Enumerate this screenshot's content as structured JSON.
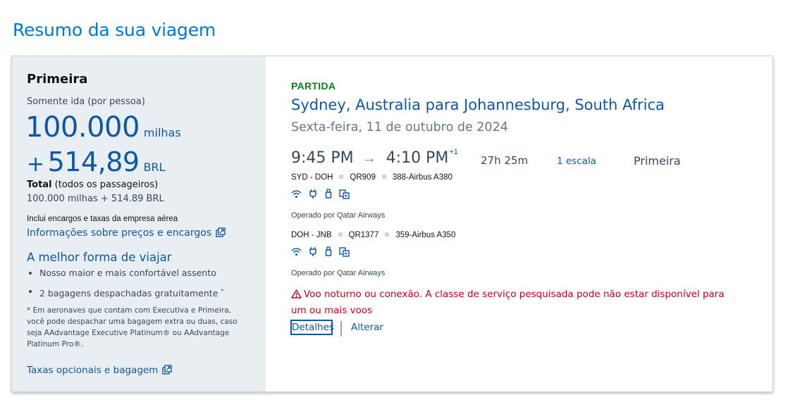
{
  "page": {
    "title": "Resumo da sua viagem"
  },
  "summary": {
    "cabin": "Primeira",
    "trip_type": "Somente ida (por pessoa)",
    "miles": "100.000",
    "miles_unit": "milhas",
    "plus": "+",
    "price": "514,89",
    "currency": "BRL",
    "total_label": "Total",
    "total_suffix": " (todos os passageiros)",
    "total_value": "100.000 milhas + 514.89 BRL",
    "fees_note": "Inclui encargos e taxas da empresa aérea",
    "price_info_link": "Informações sobre preços e encargos",
    "best_way_title": "A melhor forma de viajar",
    "benefits": [
      "Nosso maior e mais confortável assento",
      "2 bagagens despachadas gratuitamente"
    ],
    "benefit_mark": "*",
    "footnote": "* Em aeronaves que contam com Executiva e Primeira, você pode despachar uma bagagem extra ou duas, caso seja AAdvantage Executive Platinum® ou AAdvantage Platinum Pro®.",
    "optional_fees_link": "Taxas opcionais e bagagem"
  },
  "flight": {
    "direction": "PARTIDA",
    "route": "Sydney, Australia para Johannesburg, South Africa",
    "date": "Sexta-feira, 11 de outubro de 2024",
    "depart_time": "9:45 PM",
    "arrow": "→",
    "arrive_time": "4:10 PM",
    "day_offset": "+1",
    "duration": "27h 25m",
    "stops": "1 escala",
    "cabin": "Primeira",
    "segments": [
      {
        "route": "SYD - DOH",
        "flight": "QR909",
        "aircraft": "388-Airbus A380",
        "operated_by": "Operado por Qatar Airways"
      },
      {
        "route": "DOH - JNB",
        "flight": "QR1377",
        "aircraft": "359-Airbus A350",
        "operated_by": "Operado por Qatar Airways"
      }
    ],
    "amenity_icons": [
      "wifi-icon",
      "power-plug-icon",
      "usb-icon",
      "entertainment-icon"
    ],
    "warning": "Voo noturno ou conexão. A classe de serviço pesquisada pode não estar disponível para um ou mais voos",
    "details_label": "Detalhes",
    "change_label": "Alterar"
  },
  "colors": {
    "brand_blue": "#0078d2",
    "link_blue": "#0c58a6",
    "departure_green": "#008715",
    "warning_red": "#c30019",
    "panel_gray": "#e9eef2"
  }
}
